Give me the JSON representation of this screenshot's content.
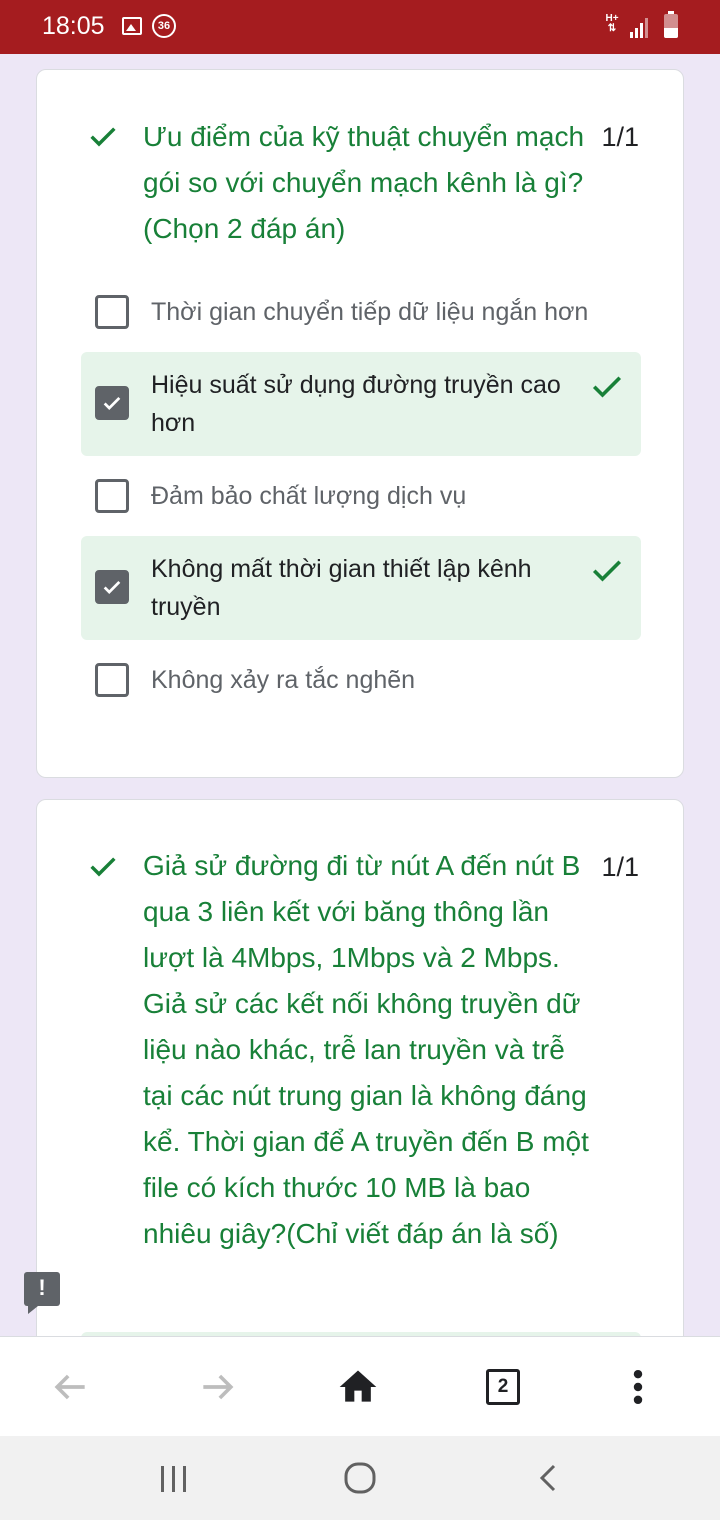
{
  "status_bar": {
    "time": "18:05",
    "notification_count": "36",
    "network_type": "H+",
    "icons": [
      "gallery-icon",
      "notification-count-icon",
      "network-h-plus-icon",
      "signal-icon",
      "battery-icon"
    ]
  },
  "questions": [
    {
      "text": "Ưu điểm của kỹ thuật chuyển mạch gói so với chuyển mạch kênh là gì?(Chọn 2 đáp án)",
      "score": "1/1",
      "status": "correct",
      "options": [
        {
          "label": "Thời gian chuyển tiếp dữ liệu ngắn hơn",
          "checked": false,
          "correct": false
        },
        {
          "label": "Hiệu suất sử dụng đường truyền cao hơn",
          "checked": true,
          "correct": true
        },
        {
          "label": "Đảm bảo chất lượng dịch vụ",
          "checked": false,
          "correct": false
        },
        {
          "label": "Không mất thời gian thiết lập kênh truyền",
          "checked": true,
          "correct": true
        },
        {
          "label": "Không xảy ra tắc nghẽn",
          "checked": false,
          "correct": false
        }
      ]
    },
    {
      "text": "Giả sử đường đi từ nút A đến nút B qua 3 liên kết với băng thông lần lượt là 4Mbps, 1Mbps và 2 Mbps. Giả sử các kết nối không truyền dữ liệu nào khác, trễ lan truyền và trễ tại các nút trung gian là không đáng kể. Thời gian để A truyền đến B một file có kích thước 10 MB là bao nhiêu giây?(Chỉ viết đáp án là số)",
      "score": "1/1",
      "status": "correct"
    }
  ],
  "browser_bar": {
    "tab_count": "2",
    "icons": [
      "back-arrow-icon",
      "forward-arrow-icon",
      "home-icon",
      "tab-switcher-icon",
      "more-vert-icon"
    ]
  },
  "system_nav": {
    "icons": [
      "recent-apps-icon",
      "home-circle-icon",
      "system-back-icon"
    ]
  },
  "colors": {
    "status_bar": "#a51c1f",
    "correct_green": "#188038",
    "correct_bg": "#e6f4ea",
    "page_bg": "#ede7f6"
  }
}
